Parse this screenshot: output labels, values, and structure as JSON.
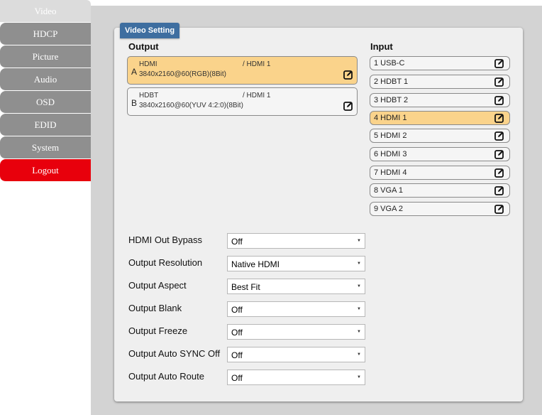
{
  "sidebar": {
    "items": [
      {
        "label": "Video"
      },
      {
        "label": "HDCP"
      },
      {
        "label": "Picture"
      },
      {
        "label": "Audio"
      },
      {
        "label": "OSD"
      },
      {
        "label": "EDID"
      },
      {
        "label": "System"
      },
      {
        "label": "Logout"
      }
    ]
  },
  "card": {
    "tab_label": "Video Setting"
  },
  "output": {
    "title": "Output",
    "items": [
      {
        "letter": "A",
        "name": "HDMI",
        "route": "/ HDMI 1",
        "format": "3840x2160@60(RGB)(8Bit)"
      },
      {
        "letter": "B",
        "name": "HDBT",
        "route": "/ HDMI 1",
        "format": "3840x2160@60(YUV 4:2:0)(8Bit)"
      }
    ]
  },
  "input": {
    "title": "Input",
    "items": [
      {
        "label": "1  USB-C"
      },
      {
        "label": "2  HDBT 1"
      },
      {
        "label": "3  HDBT 2"
      },
      {
        "label": "4  HDMI 1"
      },
      {
        "label": "5  HDMI 2"
      },
      {
        "label": "6  HDMI 3"
      },
      {
        "label": "7  HDMI 4"
      },
      {
        "label": "8  VGA 1"
      },
      {
        "label": "9  VGA 2"
      }
    ]
  },
  "settings": [
    {
      "label": "HDMI Out Bypass",
      "value": "Off"
    },
    {
      "label": "Output Resolution",
      "value": "Native HDMI"
    },
    {
      "label": "Output Aspect",
      "value": "Best Fit"
    },
    {
      "label": "Output Blank",
      "value": "Off"
    },
    {
      "label": "Output Freeze",
      "value": "Off"
    },
    {
      "label": "Output Auto SYNC Off",
      "value": "Off"
    },
    {
      "label": "Output Auto Route",
      "value": "Off"
    }
  ],
  "icons": {
    "edit": "edit-icon",
    "dropdown": "triangle-down"
  },
  "colors": {
    "selected": "#fad38b",
    "logout": "#e8000c",
    "tab": "#3e6ea0",
    "nav": "#8f8f8f"
  }
}
